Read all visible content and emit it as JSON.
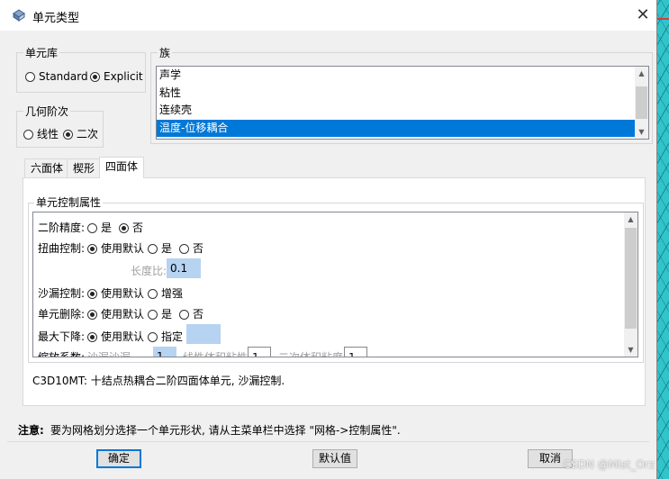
{
  "window": {
    "title": "单元类型",
    "close_glyph": "✕"
  },
  "element_library": {
    "label": "单元库",
    "options": [
      "Standard",
      "Explicit"
    ],
    "selected": "Explicit"
  },
  "geometric_order": {
    "label": "几何阶次",
    "options": [
      "线性",
      "二次"
    ],
    "selected": "二次"
  },
  "family": {
    "label": "族",
    "items": [
      "声学",
      "粘性",
      "连续壳",
      "温度-位移耦合"
    ],
    "selected": "温度-位移耦合"
  },
  "tabs": [
    {
      "label": "六面体",
      "active": false
    },
    {
      "label": "楔形",
      "active": false
    },
    {
      "label": "四面体",
      "active": true
    }
  ],
  "controls": {
    "label": "单元控制属性",
    "second_order_accuracy": {
      "label": "二阶精度:",
      "yes": "是",
      "no": "否",
      "selected": "否"
    },
    "distortion_control": {
      "label": "扭曲控制:",
      "default": "使用默认",
      "yes": "是",
      "no": "否",
      "selected": "使用默认"
    },
    "length_ratio": {
      "label": "长度比:",
      "value": "0.1"
    },
    "hourglass_control": {
      "label": "沙漏控制:",
      "default": "使用默认",
      "enhanced": "增强",
      "selected": "使用默认"
    },
    "element_deletion": {
      "label": "单元删除:",
      "default": "使用默认",
      "yes": "是",
      "no": "否",
      "selected": "使用默认"
    },
    "max_degradation": {
      "label": "最大下降:",
      "default": "使用默认",
      "specify": "指定",
      "selected": "使用默认",
      "value": ""
    },
    "scaling": {
      "label": "缩放系数:",
      "hourglass": "沙漏沙漏",
      "hourglass_value": "1",
      "linear_bulk": "线性体积粘性",
      "linear_bulk_value": "1",
      "quad_bulk": "二次体积粘度",
      "quad_bulk_value": "1"
    }
  },
  "description": "C3D10MT:  十结点热耦合二阶四面体单元, 沙漏控制.",
  "note": {
    "label": "注意:",
    "text": "要为网格划分选择一个单元形状, 请从主菜单栏中选择 \"网格->控制属性\"."
  },
  "buttons": {
    "ok": "确定",
    "defaults": "默认值",
    "cancel": "取消"
  },
  "watermark": "CSDN @Mist_Orz"
}
